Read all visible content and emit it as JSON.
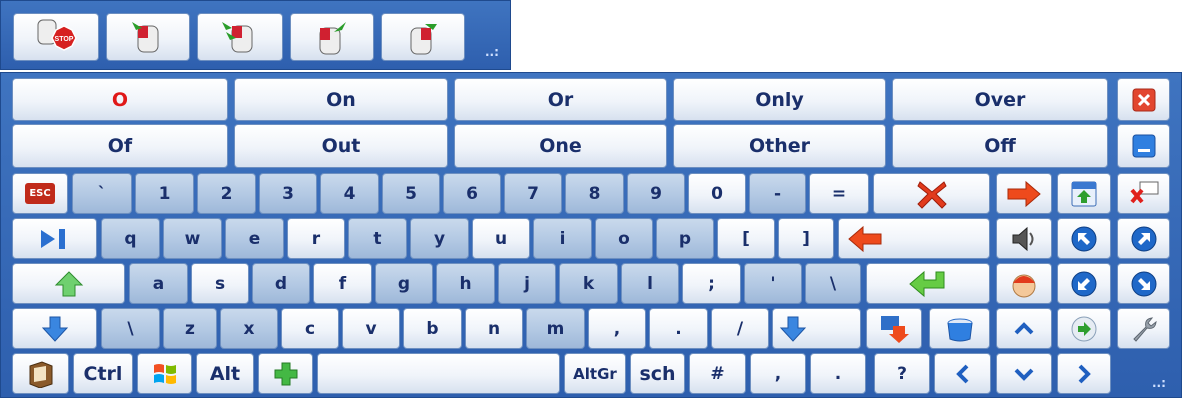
{
  "colors": {
    "panel": "#3569b8",
    "key_text": "#1a2f6b",
    "first_suggestion": "#e01818",
    "key_blue": "#b2c8e3"
  },
  "toolbar": {
    "buttons": [
      {
        "icon": "stop-mouse-icon",
        "label": "STOP"
      },
      {
        "icon": "mouse-left-click-icon"
      },
      {
        "icon": "mouse-double-click-icon"
      },
      {
        "icon": "mouse-drag-icon"
      },
      {
        "icon": "mouse-right-click-icon"
      }
    ],
    "grip": "..:"
  },
  "suggestions": {
    "row1": [
      "O",
      "On",
      "Or",
      "Only",
      "Over"
    ],
    "row2": [
      "Of",
      "Out",
      "One",
      "Other",
      "Off"
    ]
  },
  "keys": {
    "esc": "ESC",
    "row_numbers": [
      "`",
      "1",
      "2",
      "3",
      "4",
      "5",
      "6",
      "7",
      "8",
      "9",
      "0",
      "-",
      "="
    ],
    "row_q": [
      "q",
      "w",
      "e",
      "r",
      "t",
      "y",
      "u",
      "i",
      "o",
      "p",
      "[",
      "]"
    ],
    "row_a": [
      "a",
      "s",
      "d",
      "f",
      "g",
      "h",
      "j",
      "k",
      "l",
      ";",
      "'",
      "\\"
    ],
    "row_z": [
      "\\",
      "z",
      "x",
      "c",
      "v",
      "b",
      "n",
      "m",
      ",",
      ".",
      "/"
    ],
    "ctrl": "Ctrl",
    "alt": "Alt",
    "altgr": "AltGr",
    "sch": "sch",
    "hash": "#",
    "comma": ",",
    "period": ".",
    "question": "?"
  },
  "icons": [
    "close-icon",
    "minimize-icon",
    "delete-word-icon",
    "right-arrow-icon",
    "save-icon",
    "spellcheck-icon",
    "tab-icon",
    "backspace-icon",
    "speaker-icon",
    "nw-arrow-icon",
    "ne-arrow-icon",
    "shift-icon",
    "enter-icon",
    "avatar-icon",
    "sw-arrow-icon",
    "se-arrow-icon",
    "shift-down-icon",
    "caps-down-icon",
    "text-down-icon",
    "bucket-icon",
    "up-chevron-icon",
    "next-icon",
    "settings-wrench-icon",
    "dictionary-icon",
    "windows-icon",
    "add-icon",
    "left-chevron-icon",
    "down-chevron-icon",
    "right-chevron-icon"
  ]
}
